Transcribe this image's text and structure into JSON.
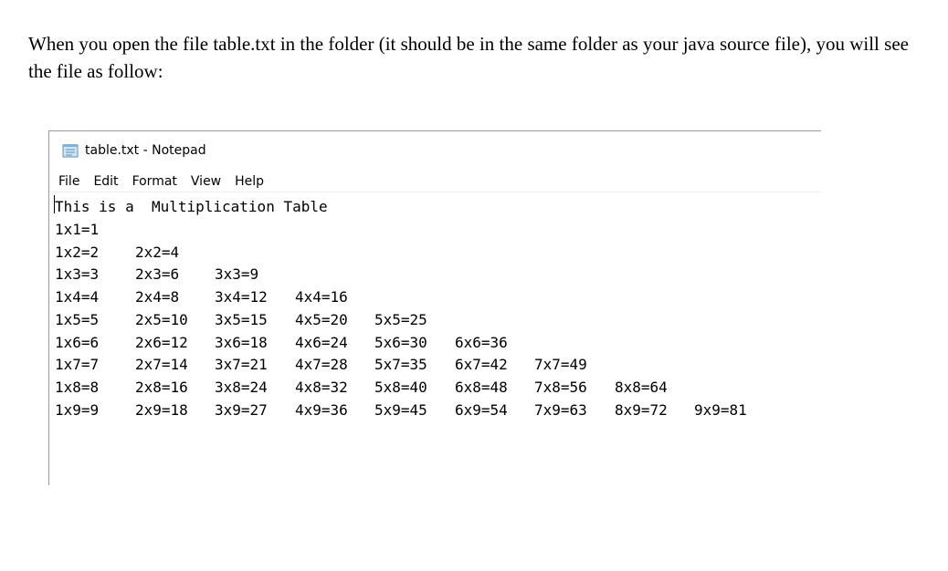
{
  "intro": {
    "text": "When you open the file table.txt in the folder (it should  be in the same folder as your java source file), you will see the file as follow:"
  },
  "window": {
    "title": "table.txt - Notepad",
    "icon": "notepad-icon"
  },
  "menu": [
    "File",
    "Edit",
    "Format",
    "View",
    "Help"
  ],
  "editor": {
    "header": "This is a  Multiplication Table",
    "rows": [
      [
        "1x1=1"
      ],
      [
        "1x2=2",
        "2x2=4"
      ],
      [
        "1x3=3",
        "2x3=6",
        "3x3=9"
      ],
      [
        "1x4=4",
        "2x4=8",
        "3x4=12",
        "4x4=16"
      ],
      [
        "1x5=5",
        "2x5=10",
        "3x5=15",
        "4x5=20",
        "5x5=25"
      ],
      [
        "1x6=6",
        "2x6=12",
        "3x6=18",
        "4x6=24",
        "5x6=30",
        "6x6=36"
      ],
      [
        "1x7=7",
        "2x7=14",
        "3x7=21",
        "4x7=28",
        "5x7=35",
        "6x7=42",
        "7x7=49"
      ],
      [
        "1x8=8",
        "2x8=16",
        "3x8=24",
        "4x8=32",
        "5x8=40",
        "6x8=48",
        "7x8=56",
        "8x8=64"
      ],
      [
        "1x9=9",
        "2x9=18",
        "3x9=27",
        "4x9=36",
        "5x9=45",
        "6x9=54",
        "7x9=63",
        "8x9=72",
        "9x9=81"
      ]
    ]
  }
}
